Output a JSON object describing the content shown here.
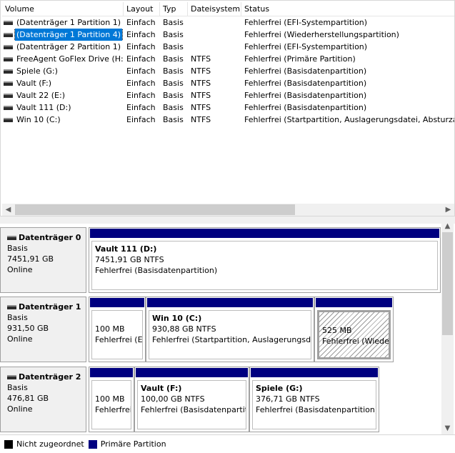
{
  "columns": [
    "Volume",
    "Layout",
    "Typ",
    "Dateisystem",
    "Status"
  ],
  "volumes": [
    {
      "name": "(Datenträger 1 Partition 1)",
      "layout": "Einfach",
      "type": "Basis",
      "fs": "",
      "status": "Fehlerfrei (EFI-Systempartition)"
    },
    {
      "name": "(Datenträger 1 Partition 4)",
      "layout": "Einfach",
      "type": "Basis",
      "fs": "",
      "status": "Fehlerfrei (Wiederherstellungspartition)"
    },
    {
      "name": "(Datenträger 2 Partition 1)",
      "layout": "Einfach",
      "type": "Basis",
      "fs": "",
      "status": "Fehlerfrei (EFI-Systempartition)"
    },
    {
      "name": "FreeAgent GoFlex Drive (H:)",
      "layout": "Einfach",
      "type": "Basis",
      "fs": "NTFS",
      "status": "Fehlerfrei (Primäre Partition)"
    },
    {
      "name": "Spiele (G:)",
      "layout": "Einfach",
      "type": "Basis",
      "fs": "NTFS",
      "status": "Fehlerfrei (Basisdatenpartition)"
    },
    {
      "name": "Vault (F:)",
      "layout": "Einfach",
      "type": "Basis",
      "fs": "NTFS",
      "status": "Fehlerfrei (Basisdatenpartition)"
    },
    {
      "name": "Vault 22 (E:)",
      "layout": "Einfach",
      "type": "Basis",
      "fs": "NTFS",
      "status": "Fehlerfrei (Basisdatenpartition)"
    },
    {
      "name": "Vault 111 (D:)",
      "layout": "Einfach",
      "type": "Basis",
      "fs": "NTFS",
      "status": "Fehlerfrei (Basisdatenpartition)"
    },
    {
      "name": "Win 10 (C:)",
      "layout": "Einfach",
      "type": "Basis",
      "fs": "NTFS",
      "status": "Fehlerfrei (Startpartition, Auslagerungsdatei, Absturzabb"
    }
  ],
  "disks": [
    {
      "name": "Datenträger 0",
      "type": "Basis",
      "size": "7451,91 GB",
      "state": "Online",
      "partitions": [
        {
          "title": "Vault 111  (D:)",
          "size": "7451,91 GB NTFS",
          "status": "Fehlerfrei (Basisdatenpartition)"
        }
      ]
    },
    {
      "name": "Datenträger 1",
      "type": "Basis",
      "size": "931,50 GB",
      "state": "Online",
      "partitions": [
        {
          "title": "",
          "size": "100 MB",
          "status": "Fehlerfrei (E"
        },
        {
          "title": "Win 10  (C:)",
          "size": "930,88 GB NTFS",
          "status": "Fehlerfrei (Startpartition, Auslagerungsdat"
        },
        {
          "title": "",
          "size": "525 MB",
          "status": "Fehlerfrei (Wieder"
        }
      ]
    },
    {
      "name": "Datenträger 2",
      "type": "Basis",
      "size": "476,81 GB",
      "state": "Online",
      "partitions": [
        {
          "title": "",
          "size": "100 MB",
          "status": "Fehlerfrei"
        },
        {
          "title": "Vault  (F:)",
          "size": "100,00 GB NTFS",
          "status": "Fehlerfrei (Basisdatenpartitio"
        },
        {
          "title": "Spiele  (G:)",
          "size": "376,71 GB NTFS",
          "status": "Fehlerfrei (Basisdatenpartition)"
        }
      ]
    }
  ],
  "legend": [
    {
      "label": "Nicht zugeordnet",
      "color": "#000000"
    },
    {
      "label": "Primäre Partition",
      "color": "#000080"
    }
  ],
  "colors": {
    "partition_bar": "#000080",
    "selection": "#0078d7"
  },
  "icons": {
    "scroll_left": "◀",
    "scroll_right": "▶",
    "scroll_up": "▲",
    "scroll_down": "▼"
  }
}
